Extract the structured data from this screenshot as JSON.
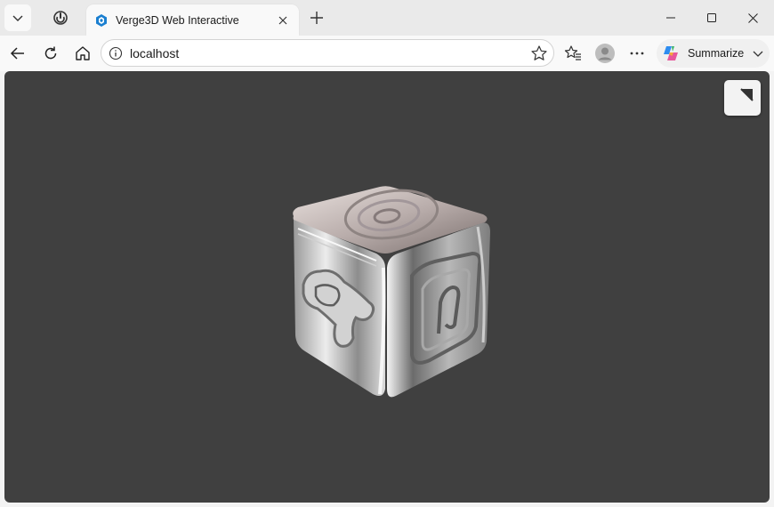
{
  "browser": {
    "tab": {
      "title": "Verge3D Web Interactive",
      "favicon": "verge3d-logo-icon"
    },
    "address": {
      "url": "localhost"
    },
    "summarize_label": "Summarize"
  },
  "viewport": {
    "background": "#404040",
    "scene": "chrome-rounded-cube",
    "fullscreen_button": "fullscreen-toggle-icon"
  }
}
